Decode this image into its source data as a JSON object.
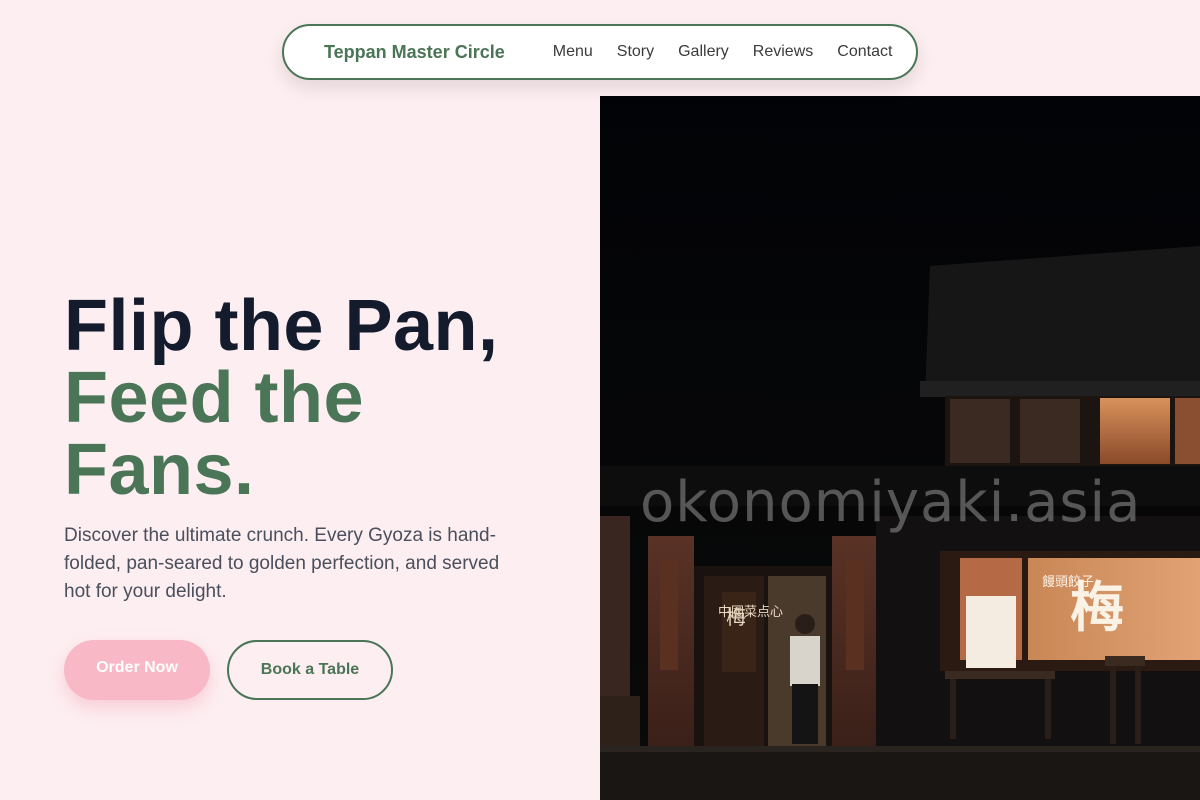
{
  "nav": {
    "brand": "Teppan Master Circle",
    "links": [
      "Menu",
      "Story",
      "Gallery",
      "Reviews",
      "Contact"
    ]
  },
  "hero": {
    "headline_line1": "Flip the Pan,",
    "headline_line2": "Feed the",
    "headline_line3": "Fans.",
    "description": "Discover the ultimate crunch. Every Gyoza is hand-folded, pan-seared to golden perfection, and served hot for your delight.",
    "primary_button": "Order Now",
    "secondary_button": "Book a Table"
  },
  "image": {
    "watermark": "okonomiyaki.asia",
    "sign_kanji": "梅",
    "sign_side_text": "饅頭餃子",
    "door_sign_text": "中國菜点心"
  },
  "colors": {
    "background": "#fdeef1",
    "accent_green": "#4a7556",
    "headline_dark": "#141b2d",
    "button_pink": "#f8b8c6"
  }
}
